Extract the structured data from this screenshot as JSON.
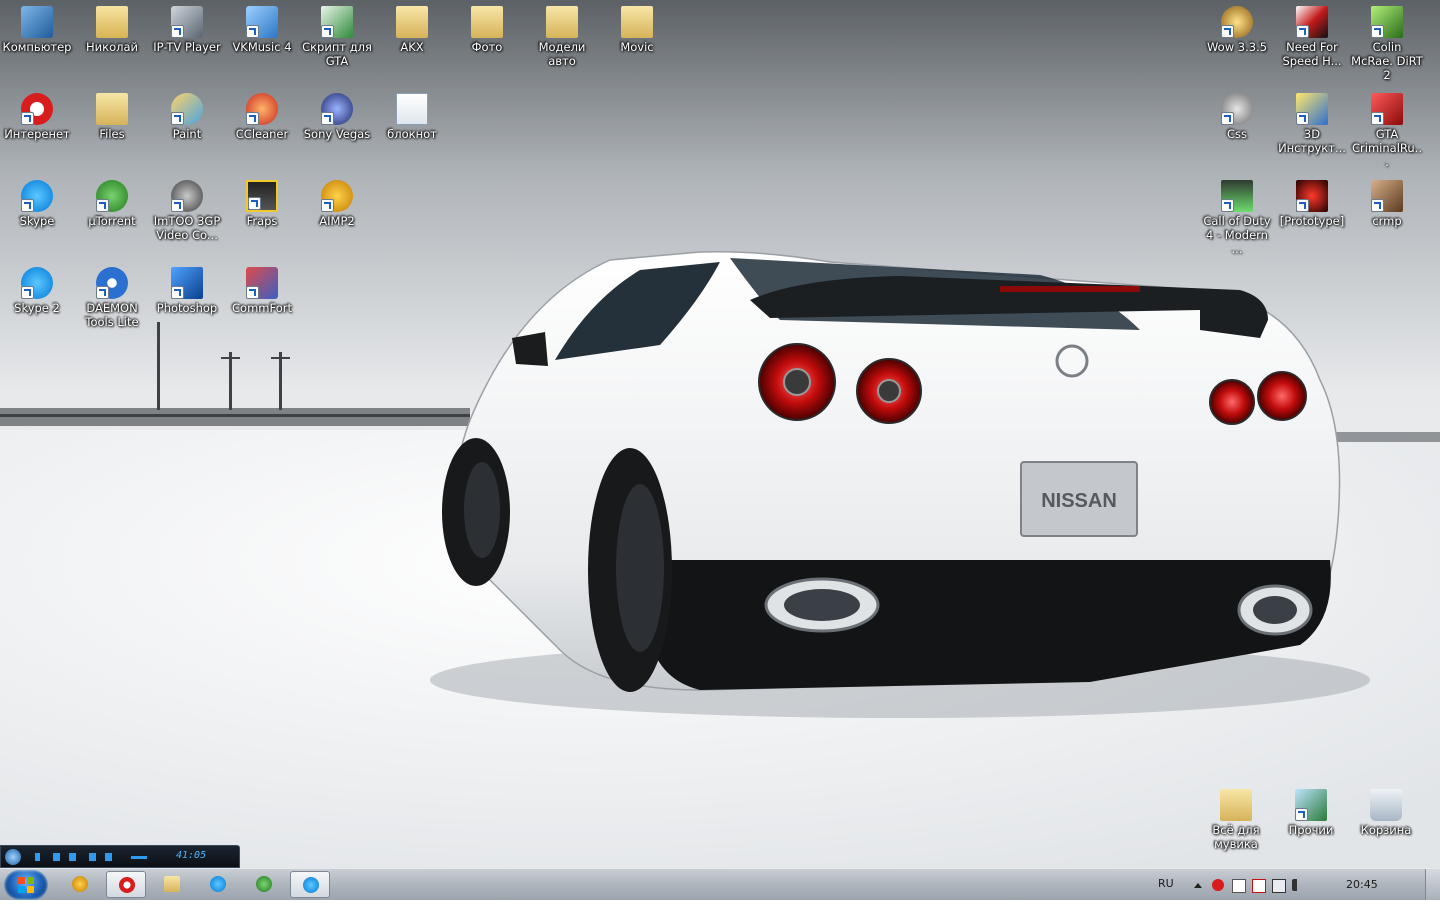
{
  "desktop": {
    "left_icons": [
      {
        "label": "Компьютер",
        "icon": "computer-icon"
      },
      {
        "label": "Николай",
        "icon": "user-folder-icon"
      },
      {
        "label": "IP-TV Player",
        "icon": "iptv-icon"
      },
      {
        "label": "VKMusic 4",
        "icon": "vkmusic-icon"
      },
      {
        "label": "Скрипт для GTA",
        "icon": "script-file-icon"
      },
      {
        "label": "AKX",
        "icon": "folder-icon"
      },
      {
        "label": "Фото",
        "icon": "folder-icon"
      },
      {
        "label": "Модели авто",
        "icon": "folder-icon"
      },
      {
        "label": "Movic",
        "icon": "folder-icon"
      },
      {
        "label": "Интеренет",
        "icon": "opera-icon"
      },
      {
        "label": "Files",
        "icon": "folder-icon"
      },
      {
        "label": "Paint",
        "icon": "paint-icon"
      },
      {
        "label": "CCleaner",
        "icon": "ccleaner-icon"
      },
      {
        "label": "Sony Vegas",
        "icon": "vegas-icon"
      },
      {
        "label": "блокнот",
        "icon": "notepad-icon"
      },
      {
        "label": "Skype",
        "icon": "skype-icon"
      },
      {
        "label": "µTorrent",
        "icon": "utorrent-icon"
      },
      {
        "label": "ImTOO 3GP Video Co...",
        "icon": "film-reel-icon"
      },
      {
        "label": "Fraps",
        "icon": "fraps-icon"
      },
      {
        "label": "AIMP2",
        "icon": "aimp-icon"
      },
      {
        "label": "Skype 2",
        "icon": "skype-icon"
      },
      {
        "label": "DAEMON Tools Lite",
        "icon": "daemon-tools-icon"
      },
      {
        "label": "Photoshop",
        "icon": "photoshop-icon"
      },
      {
        "label": "CommFort",
        "icon": "commfort-icon"
      }
    ],
    "right_icons": [
      {
        "label": "Wow 3.3.5",
        "icon": "wow-icon"
      },
      {
        "label": "Need For Speed H...",
        "icon": "nfs-icon"
      },
      {
        "label": "Colin McRae. DiRT 2",
        "icon": "dirt-icon"
      },
      {
        "label": "Css",
        "icon": "css-game-icon"
      },
      {
        "label": "3D Инструкт...",
        "icon": "3d-instructor-icon"
      },
      {
        "label": "GTA CriminalRu...",
        "icon": "gta-icon"
      },
      {
        "label": "Call of Duty 4 - Modern ...",
        "icon": "cod4-icon"
      },
      {
        "label": "[Prototype]",
        "icon": "prototype-icon"
      },
      {
        "label": "crmp",
        "icon": "crmp-icon"
      }
    ],
    "bottom_icons": [
      {
        "label": "Всё для мувика",
        "icon": "folder-icon"
      },
      {
        "label": "Прочии",
        "icon": "shortcut-icon"
      },
      {
        "label": "Корзина",
        "icon": "recycle-bin-icon"
      }
    ],
    "wallpaper": {
      "badge_text": "NISSAN"
    }
  },
  "aimp_player": {
    "time": "41:05"
  },
  "taskbar": {
    "pinned": [
      {
        "name": "aimp",
        "icon": "aimp-icon",
        "active": false
      },
      {
        "name": "opera",
        "icon": "opera-icon",
        "active": true
      },
      {
        "name": "explorer",
        "icon": "explorer-icon",
        "active": false
      },
      {
        "name": "skype",
        "icon": "skype-icon",
        "active": false
      },
      {
        "name": "utorrent",
        "icon": "utorrent-icon",
        "active": false
      },
      {
        "name": "skype2",
        "icon": "skype-icon",
        "active": true
      }
    ],
    "language": "RU",
    "clock": "20:45"
  },
  "colors": {
    "taskbar": "#aeb5bd",
    "label_text": "#ffffff",
    "aimp_accent": "#4fb2ff"
  }
}
